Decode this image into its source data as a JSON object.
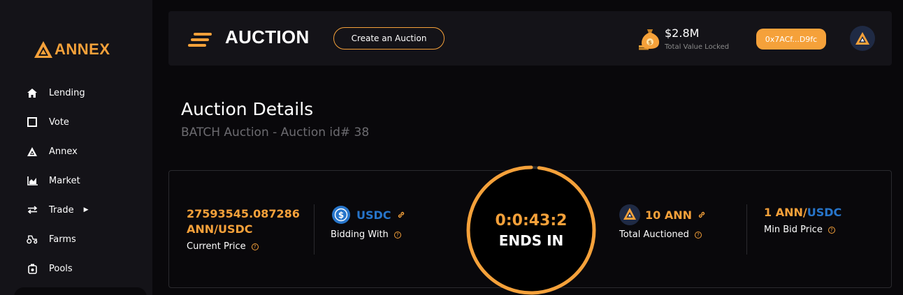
{
  "brand": {
    "name": "ANNEX",
    "accent": "#f5a13a",
    "usdc": "#2775ca"
  },
  "sidebar": {
    "items": [
      {
        "label": "Lending",
        "icon": "home-icon"
      },
      {
        "label": "Vote",
        "icon": "square-icon"
      },
      {
        "label": "Annex",
        "icon": "annex-icon"
      },
      {
        "label": "Market",
        "icon": "chart-icon"
      },
      {
        "label": "Trade",
        "icon": "swap-icon"
      },
      {
        "label": "Farms",
        "icon": "tractor-icon"
      },
      {
        "label": "Pools",
        "icon": "pool-icon"
      }
    ]
  },
  "header": {
    "title": "AUCTION",
    "create_label": "Create an Auction",
    "tvl_value": "$2.8M",
    "tvl_label": "Total Value Locked",
    "wallet": "0x7ACf...D9fc"
  },
  "details": {
    "title": "Auction Details",
    "subtitle": "BATCH Auction - Auction id# 38"
  },
  "card": {
    "price_line1": "27593545.087286",
    "price_line2": "ANN/USDC",
    "price_label": "Current Price",
    "bidding_token": "USDC",
    "bidding_label": "Bidding With",
    "timer": "0:0:43:2",
    "timer_label": "ENDS IN",
    "timer_progress": 0.98,
    "auctioned_amount": "10 ANN",
    "auctioned_label": "Total Auctioned",
    "min_bid_base": "1 ANN/",
    "min_bid_quote": "USDC",
    "min_bid_label": "Min Bid Price"
  }
}
